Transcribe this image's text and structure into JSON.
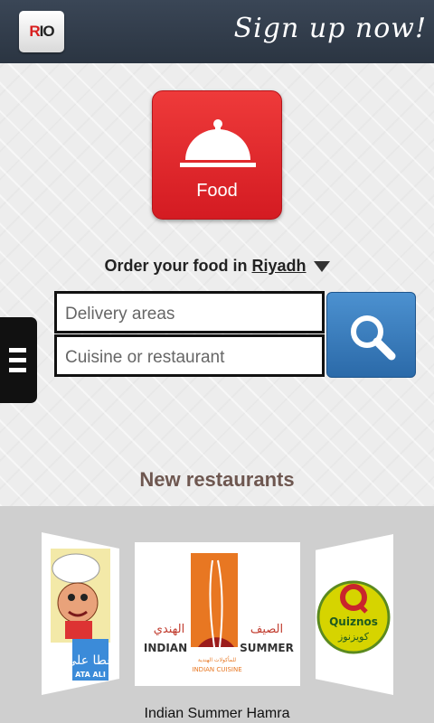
{
  "header": {
    "logo_text_r": "R",
    "logo_text_io": "IO",
    "signup_label": "Sign up now!"
  },
  "category": {
    "label": "Food",
    "icon": "cloche-icon",
    "color": "#e0252b"
  },
  "order": {
    "prefix": "Order your food in",
    "city": "Riyadh"
  },
  "search": {
    "delivery_placeholder": "Delivery areas",
    "cuisine_placeholder": "Cuisine or restaurant",
    "button_icon": "search-icon",
    "button_color": "#3a7fc0"
  },
  "new_restaurants": {
    "heading": "New restaurants",
    "cards": [
      {
        "name": "Ata Ali",
        "logo_text": "ATA ALI",
        "logo_text_ar": "عطا علي"
      },
      {
        "name": "Indian Summer Hamra",
        "logo_text_ar_1": "الهندي",
        "logo_text_ar_2": "الصيف",
        "logo_text_1": "INDIAN",
        "logo_text_2": "SUMMER",
        "logo_text_3": "INDIAN CUISINE",
        "logo_text_ar_3": "للمأكولات الهندية"
      },
      {
        "name": "Quiznos",
        "logo_text": "Quiznos",
        "logo_text_ar": "كويزنوز"
      }
    ],
    "selected_caption": "Indian Summer Hamra"
  }
}
